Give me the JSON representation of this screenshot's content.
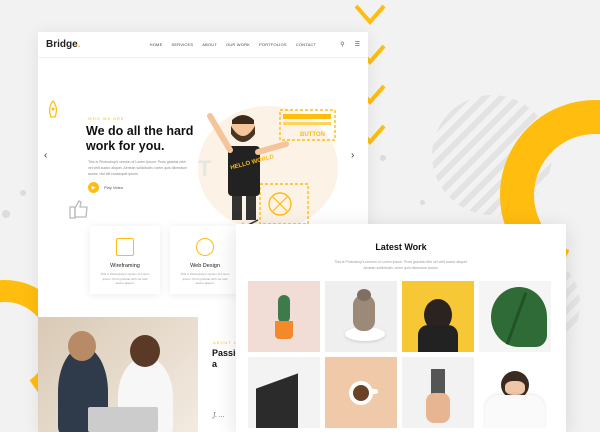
{
  "colors": {
    "accent": "#ffbd10",
    "background": "#f2f2f2",
    "text_dark": "#111111"
  },
  "nav": {
    "logo": "Bridge",
    "items": [
      "HOME",
      "SERVICES",
      "ABOUT",
      "OUR WORK",
      "PORTFOLIOS",
      "CONTACT"
    ],
    "icons": [
      "search-icon",
      "menu-icon"
    ]
  },
  "hero": {
    "eyebrow": "WHO WE ARE",
    "title": "We do all the hard work for you.",
    "text": "This is Photoshop's version of Lorem Ipsum. Proin gravida nibh vel velit auctor aliquet. Aenean sollicitudin, lorem quis bibendum auctor, nisi elit consequat ipsum.",
    "play_label": "Play Video",
    "illustration_texts": {
      "button": "BUTTON",
      "shirt": "HELLO WORLD"
    }
  },
  "features": [
    {
      "title": "Wireframing",
      "text": "This is Photoshop's version of Lorem Ipsum. Proin gravida nibh vel velit auctor aliquet.",
      "icon": "wireframe-icon"
    },
    {
      "title": "Web Design",
      "text": "This is Photoshop's version of Lorem Ipsum. Proin gravida nibh vel velit auctor aliquet.",
      "icon": "design-icon"
    }
  ],
  "about": {
    "eyebrow": "ABOUT US",
    "title": "Passion and a",
    "signature": "J. ..."
  },
  "work": {
    "title": "Latest Work",
    "text": "This is Photoshop's version of Lorem Ipsum. Proin gravida nibh vel velit auctor aliquet. Aenean sollicitudin, lorem quis bibendum auctor.",
    "tiles": [
      "cactus",
      "cat",
      "yellow portrait",
      "monstera leaf",
      "black building",
      "coffee cup",
      "hand with cup",
      "girl with blanket"
    ]
  }
}
